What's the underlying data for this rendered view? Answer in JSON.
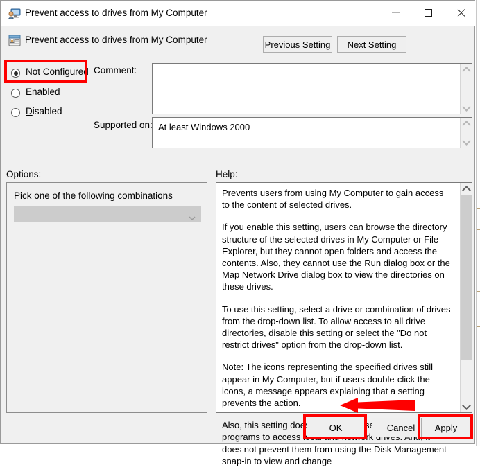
{
  "window": {
    "title": "Prevent access to drives from My Computer",
    "icon": "policy-monitor-icon",
    "minimize_label": "Minimize",
    "maximize_label": "Maximize",
    "close_label": "Close"
  },
  "header": {
    "title": "Prevent access to drives from My Computer",
    "icon": "group-policy-setting-icon",
    "previous_setting": "Previous Setting",
    "previous_mnemonic": "P",
    "next_setting": "Next Setting",
    "next_mnemonic": "N"
  },
  "state": {
    "options": [
      {
        "label": "Not Configured",
        "mnemonic": "C",
        "selected": true
      },
      {
        "label": "Enabled",
        "mnemonic": "E",
        "selected": false
      },
      {
        "label": "Disabled",
        "mnemonic": "D",
        "selected": false
      }
    ],
    "not_configured_prefix": "Not ",
    "not_configured_suffix": "onfigured",
    "enabled_suffix": "nabled",
    "disabled_suffix": "isabled"
  },
  "comment": {
    "label": "Comment:",
    "value": "",
    "placeholder": ""
  },
  "supported": {
    "label": "Supported on:",
    "value": "At least Windows 2000"
  },
  "options_panel": {
    "label": "Options:",
    "instruction": "Pick one of the following combinations",
    "dropdown_value": "",
    "dropdown_enabled": false,
    "dropdown_icon": "chevron-down-icon"
  },
  "help_panel": {
    "label": "Help:",
    "paragraphs": [
      "Prevents users from using My Computer to gain access to the content of selected drives.",
      "If you enable this setting, users can browse the directory structure of the selected drives in My Computer or File Explorer, but they cannot open folders and access the contents. Also, they cannot use the Run dialog box or the Map Network Drive dialog box to view the directories on these drives.",
      "To use this setting, select a drive or combination of drives from the drop-down list. To allow access to all drive directories, disable this setting or select the \"Do not restrict drives\" option from the drop-down list.",
      "Note: The icons representing the specified drives still appear in My Computer, but if users double-click the icons, a message appears explaining that a setting prevents the action.",
      " Also, this setting does not prevent users from using programs to access local and network drives. And, it does not prevent them from using the Disk Management snap-in to view and change"
    ],
    "scroll_up_icon": "chevron-up-icon",
    "scroll_down_icon": "chevron-down-icon"
  },
  "footer": {
    "ok": "OK",
    "cancel": "Cancel",
    "apply": "Apply",
    "apply_mnemonic": "A",
    "apply_suffix": "pply"
  },
  "annotations": {
    "color": "#fe0000",
    "highlight_not_configured": "Not Configured",
    "highlight_ok": "OK",
    "highlight_apply": "Apply",
    "arrow_target": "OK"
  }
}
